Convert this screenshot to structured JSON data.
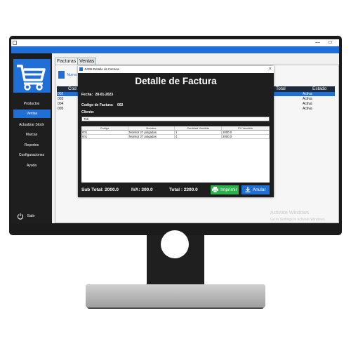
{
  "window": {
    "controls": [
      "—",
      "▭"
    ]
  },
  "sidebar": {
    "items": [
      {
        "label": "Productos",
        "active": false
      },
      {
        "label": "Ventas",
        "active": true
      },
      {
        "label": "Actualizar Stock",
        "active": false
      },
      {
        "label": "Marcas",
        "active": false
      },
      {
        "label": "Reportes",
        "active": false
      },
      {
        "label": "Configuraciones",
        "active": false
      },
      {
        "label": "Ayuda",
        "active": false
      }
    ],
    "logout_label": "Salir",
    "logo_icon": "shopping-cart-icon"
  },
  "tabs": [
    {
      "label": "Facturas",
      "selected": true
    },
    {
      "label": "Ventas",
      "selected": false
    }
  ],
  "sales_panel": {
    "new_button": "Nuevo",
    "columns": [
      "Cod",
      "Total",
      "Estado"
    ],
    "codes": [
      "002",
      "003",
      "004",
      "005"
    ],
    "states": [
      "Activa",
      "Activa",
      "Activa",
      "Activa"
    ]
  },
  "watermark": {
    "line1": "Activate Windows",
    "line2": "Go to Settings to activate Windows."
  },
  "dialog": {
    "window_title": "JVEB-Detalle de Factura",
    "heading": "Detalle de Factura",
    "fecha_label": "Fecha:",
    "fecha_value": "28-01-2023",
    "codigo_label": "Codigo de Factura:",
    "codigo_value": "002",
    "cliente_label": "Cliente:",
    "cliente_value": "Toti",
    "table_columns": [
      "Codigo",
      "Nombre",
      "Cantidad Vendida",
      "PV Vendido"
    ],
    "table_rows": [
      [
        "001",
        "Monitor 27 pulgadas",
        "1",
        "2000.0"
      ],
      [
        "001",
        "Monitor 27 pulgadas",
        "4",
        "2000.0"
      ]
    ],
    "subtotal": "Sub Total: 2000.0",
    "iva": "IVA: 300.0",
    "total": "Total : 2300.0",
    "print_button": "Imprimir",
    "cancel_button": "Anular"
  },
  "colors": {
    "accent_blue": "#1f6fd6",
    "sidebar_bg": "#1e1e1e",
    "print_green": "#2bb34b"
  }
}
